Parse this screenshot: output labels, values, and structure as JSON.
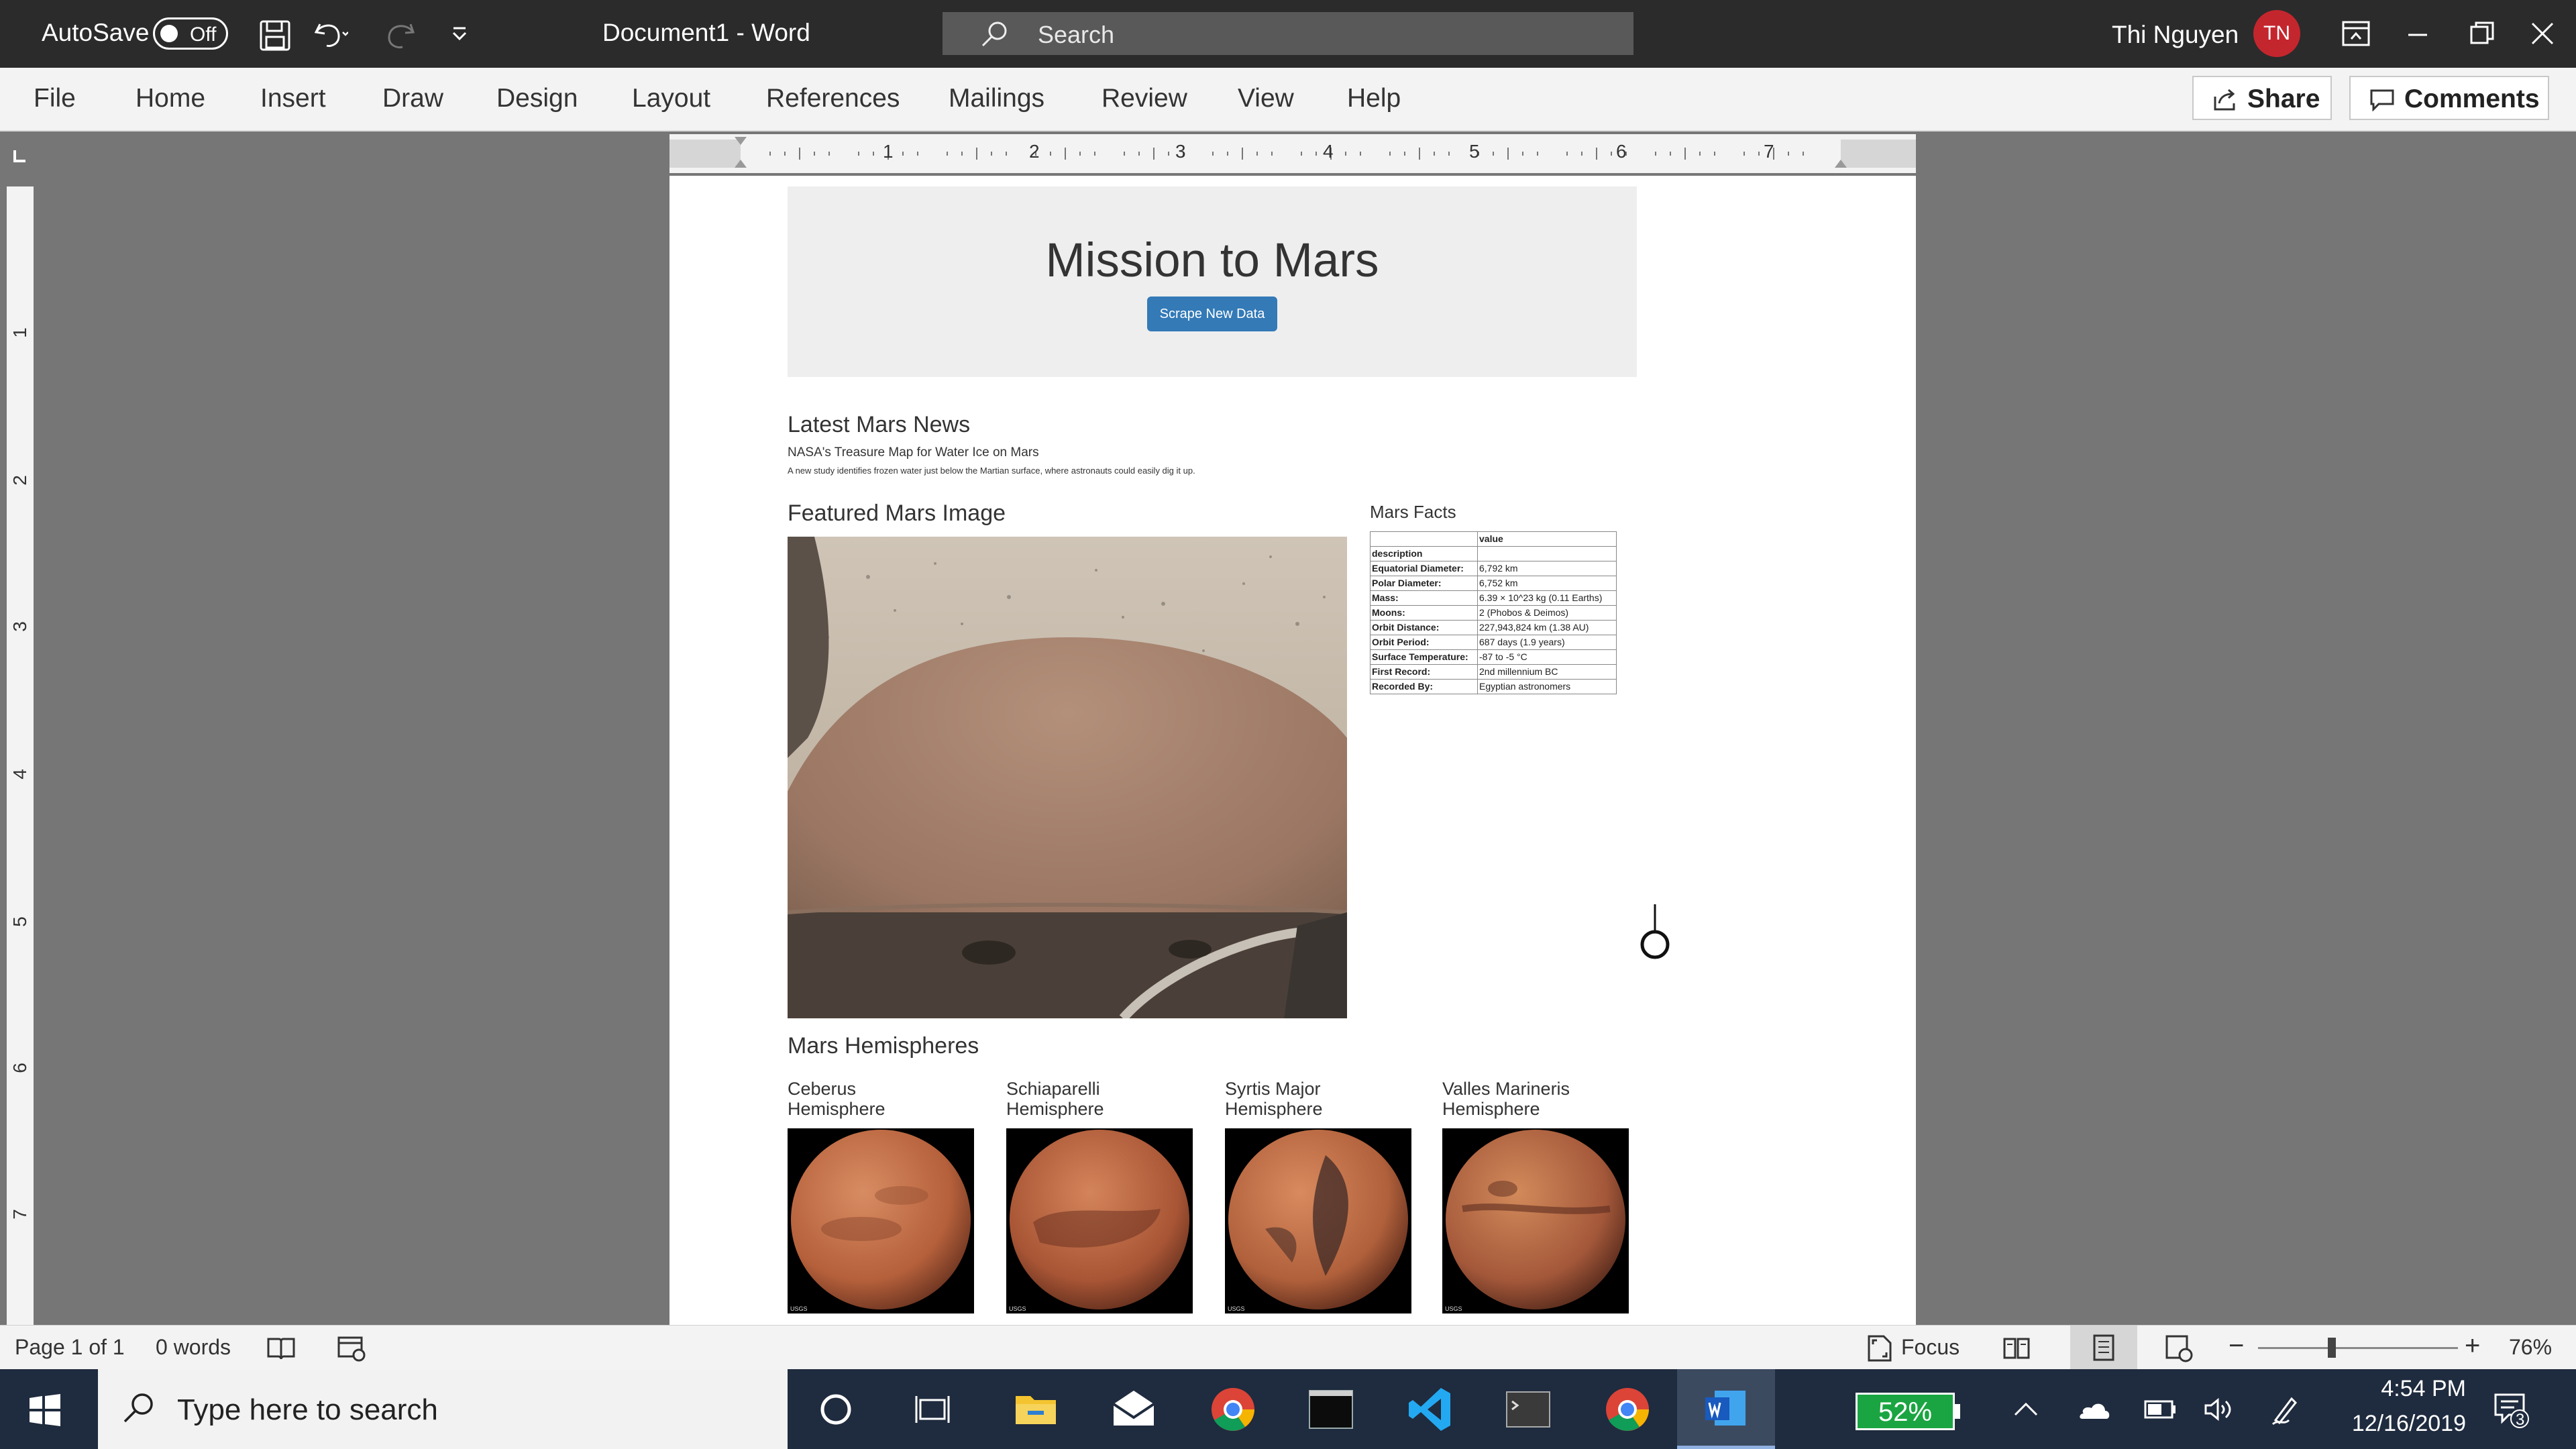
{
  "titlebar": {
    "autosave_label": "AutoSave",
    "autosave_state": "Off",
    "document_title": "Document1  -  Word",
    "search_placeholder": "Search",
    "user_name": "Thi Nguyen",
    "user_initials": "TN"
  },
  "ribbon": {
    "tabs": [
      "File",
      "Home",
      "Insert",
      "Draw",
      "Design",
      "Layout",
      "References",
      "Mailings",
      "Review",
      "View",
      "Help"
    ],
    "share_label": "Share",
    "comments_label": "Comments"
  },
  "rulers": {
    "horizontal_numbers": [
      "1",
      "2",
      "3",
      "4",
      "5",
      "6",
      "7"
    ],
    "vertical_numbers": [
      "1",
      "2",
      "3",
      "4",
      "5",
      "6",
      "7"
    ]
  },
  "document": {
    "header_title": "Mission to Mars",
    "scrape_button": "Scrape New Data",
    "news_heading": "Latest Mars News",
    "news_title": "NASA's Treasure Map for Water Ice on Mars",
    "news_paragraph": "A new study identifies frozen water just below the Martian surface, where astronauts could easily dig it up.",
    "featured_heading": "Featured Mars Image",
    "facts_heading": "Mars Facts",
    "facts_table": {
      "header": "value",
      "index_label": "description",
      "rows": [
        {
          "key": "Equatorial Diameter:",
          "value": "6,792 km"
        },
        {
          "key": "Polar Diameter:",
          "value": "6,752 km"
        },
        {
          "key": "Mass:",
          "value": "6.39 × 10^23 kg (0.11 Earths)"
        },
        {
          "key": "Moons:",
          "value": "2 (Phobos & Deimos)"
        },
        {
          "key": "Orbit Distance:",
          "value": "227,943,824 km (1.38 AU)"
        },
        {
          "key": "Orbit Period:",
          "value": "687 days (1.9 years)"
        },
        {
          "key": "Surface Temperature:",
          "value": "-87 to -5 °C"
        },
        {
          "key": "First Record:",
          "value": "2nd millennium BC"
        },
        {
          "key": "Recorded By:",
          "value": "Egyptian astronomers"
        }
      ]
    },
    "hemispheres_heading": "Mars Hemispheres",
    "hemispheres": [
      {
        "line1": "Ceberus",
        "line2": "Hemisphere"
      },
      {
        "line1": "Schiaparelli",
        "line2": "Hemisphere"
      },
      {
        "line1": "Syrtis Major",
        "line2": "Hemisphere"
      },
      {
        "line1": "Valles Marineris",
        "line2": "Hemisphere"
      }
    ],
    "usgs_label": "USGS"
  },
  "statusbar": {
    "page_info": "Page 1 of 1",
    "word_count": "0 words",
    "focus_label": "Focus",
    "zoom_minus": "−",
    "zoom_plus": "+",
    "zoom_level": "76%"
  },
  "taskbar": {
    "search_placeholder": "Type here to search",
    "battery": "52%",
    "time": "4:54 PM",
    "date": "12/16/2019",
    "notification_count": "3"
  },
  "colors": {
    "titlebar_bg": "#2b2b2b",
    "ribbon_bg": "#f3f3f3",
    "canvas_bg": "#767676",
    "button_blue": "#337ab7",
    "avatar_red": "#c4262e",
    "taskbar_bg": "#1f2b3e",
    "battery_green": "#1aa542"
  }
}
